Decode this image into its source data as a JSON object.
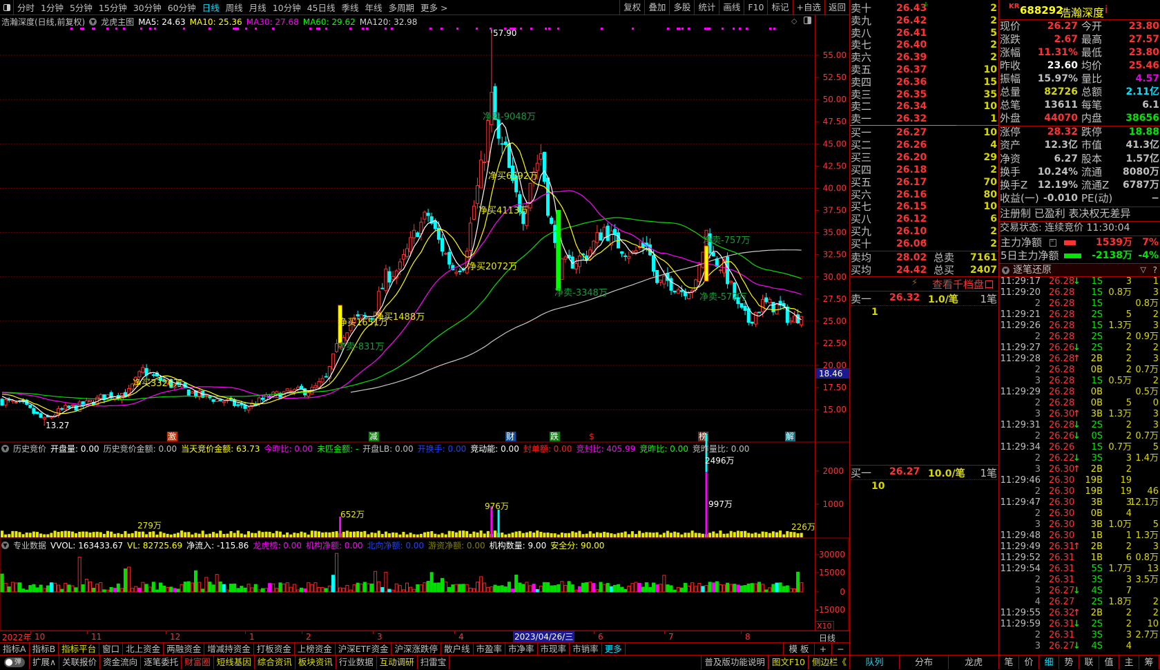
{
  "toolbar": {
    "periods": [
      "分时",
      "1分钟",
      "5分钟",
      "15分钟",
      "30分钟",
      "60分钟",
      "日线",
      "周线",
      "月线",
      "10分钟",
      "45日线",
      "季线",
      "年线",
      "多周期",
      "更多 >"
    ],
    "active": "日线",
    "actions": [
      "复权",
      "叠加",
      "多股",
      "统计",
      "画线",
      "F10",
      "标记",
      "+自选",
      "返回"
    ]
  },
  "info": {
    "title": "浩瀚深度(日线,前复权)",
    "mode": "龙虎主图",
    "ma": [
      {
        "text": "MA5: 24.63",
        "color": "#ffffff"
      },
      {
        "text": "MA10: 25.36",
        "color": "#ffff00"
      },
      {
        "text": "MA30: 27.68",
        "color": "#ff00ff"
      },
      {
        "text": "MA60: 29.62",
        "color": "#00ff00"
      },
      {
        "text": "MA120: 32.98",
        "color": "#d0d0d0"
      }
    ]
  },
  "price_axis": [
    "55.00",
    "52.50",
    "50.00",
    "47.50",
    "45.00",
    "42.50",
    "40.00",
    "37.50",
    "35.00",
    "32.50",
    "30.00",
    "27.50",
    "25.00",
    "22.50",
    "20.00",
    "17.50",
    "15.00"
  ],
  "current_marker": "18.46",
  "peak_label": "57.90",
  "low_label": "13.27",
  "annotations": [
    {
      "text": "净买3326万",
      "type": "buy"
    },
    {
      "text": "净卖-831万",
      "type": "sell"
    },
    {
      "text": "净买1651万",
      "type": "buy"
    },
    {
      "text": "净买1488万",
      "type": "buy"
    },
    {
      "text": "净买2072万",
      "type": "buy"
    },
    {
      "text": "净买4113万",
      "type": "buy"
    },
    {
      "text": "净买6592万",
      "type": "buy"
    },
    {
      "text": "净卖-9048万",
      "type": "sell"
    },
    {
      "text": "净卖-3348万",
      "type": "sell"
    },
    {
      "text": "净卖-757万",
      "type": "sell"
    },
    {
      "text": "净卖-572万",
      "type": "sell"
    }
  ],
  "events": [
    {
      "label": "激",
      "color": "#c03000"
    },
    {
      "label": "减",
      "color": "#108010"
    },
    {
      "label": "财",
      "color": "#1050a0"
    },
    {
      "label": "跌",
      "color": "#108010"
    },
    {
      "label": "$",
      "color": "#000000"
    },
    {
      "label": "榜",
      "color": "#703020"
    },
    {
      "label": "解",
      "color": "#107080"
    }
  ],
  "kline": {
    "count": 228,
    "keypoints": [
      [
        0,
        16
      ],
      [
        6,
        15.5
      ],
      [
        12,
        13.8
      ],
      [
        17,
        15
      ],
      [
        23,
        15.5
      ],
      [
        29,
        16.5
      ],
      [
        36,
        17
      ],
      [
        40,
        19.5
      ],
      [
        44,
        18.5
      ],
      [
        50,
        17.5
      ],
      [
        57,
        16.5
      ],
      [
        63,
        16
      ],
      [
        69,
        15.2
      ],
      [
        76,
        16.5
      ],
      [
        82,
        17
      ],
      [
        88,
        17.2
      ],
      [
        92,
        18.5
      ],
      [
        96,
        23
      ],
      [
        99,
        25
      ],
      [
        105,
        25.5
      ],
      [
        109,
        30
      ],
      [
        113,
        31
      ],
      [
        118,
        35.5
      ],
      [
        121,
        37
      ],
      [
        124,
        34
      ],
      [
        128,
        31
      ],
      [
        131,
        31.5
      ],
      [
        134,
        38
      ],
      [
        137,
        44
      ],
      [
        139,
        50
      ],
      [
        141,
        45
      ],
      [
        143,
        44
      ],
      [
        145,
        40
      ],
      [
        148,
        37
      ],
      [
        150,
        41
      ],
      [
        153,
        44
      ],
      [
        155,
        38
      ],
      [
        158,
        31
      ],
      [
        161,
        31.5
      ],
      [
        166,
        32.5
      ],
      [
        171,
        35.5
      ],
      [
        174,
        34
      ],
      [
        179,
        32.5
      ],
      [
        183,
        34
      ],
      [
        186,
        29
      ],
      [
        189,
        29.5
      ],
      [
        193,
        28.5
      ],
      [
        197,
        29
      ],
      [
        200,
        35
      ],
      [
        202,
        32
      ],
      [
        205,
        31
      ],
      [
        209,
        26.5
      ],
      [
        212,
        25
      ],
      [
        216,
        27
      ],
      [
        221,
        26.5
      ],
      [
        224,
        25
      ],
      [
        226,
        25.5
      ],
      [
        227,
        26.3
      ]
    ]
  },
  "ind1": {
    "items": [
      {
        "text": "开盘量: 0.00",
        "color": "#ffffff"
      },
      {
        "text": "历史竞价金额: 0.00",
        "color": "#c0c0c0"
      },
      {
        "text": "当天竞价金额: 63.73",
        "color": "#ffff00"
      },
      {
        "text": "今昨比: 0.00",
        "color": "#ff00ff"
      },
      {
        "text": "未匹金额: -",
        "color": "#00ff00"
      },
      {
        "text": "开盘LB: 0.00",
        "color": "#c0c0c0"
      },
      {
        "text": "开换手: 0.00",
        "color": "#2040ff"
      },
      {
        "text": "竞动能: 0.00",
        "color": "#ffffff"
      },
      {
        "text": "封单额: 0.00",
        "color": "#ff2020"
      },
      {
        "text": "竞封比: 405.99",
        "color": "#ff00ff"
      },
      {
        "text": "竞昨比: 0.00",
        "color": "#00ff00"
      },
      {
        "text": "竞昨量比: 0.00",
        "color": "#c0c0c0"
      }
    ],
    "title": "历史竞价",
    "axis": [
      "2000",
      "1000"
    ],
    "labels": [
      "2496万",
      "997万",
      "652万",
      "976万",
      "279万",
      "226万"
    ]
  },
  "ind2": {
    "title": "专业数据",
    "items": [
      {
        "text": "VVOL: 163433.67",
        "color": "#ffffff"
      },
      {
        "text": "VL: 82725.69",
        "color": "#ffff00"
      },
      {
        "text": "净流入: -115.86",
        "color": "#ffffff"
      },
      {
        "text": "龙虎榜: 0.00",
        "color": "#ff00ff"
      },
      {
        "text": "机构净额: 0.00",
        "color": "#ff00ff"
      },
      {
        "text": "北向净额: 0.00",
        "color": "#2040ff"
      },
      {
        "text": "游资净额: 0.00",
        "color": "#808000"
      },
      {
        "text": "机构数量: 9.00",
        "color": "#ffffff"
      },
      {
        "text": "安全分: 90.00",
        "color": "#ffff00"
      }
    ],
    "axis": [
      "30000",
      "15000",
      "0",
      "-15000"
    ],
    "scale": "X10"
  },
  "date_axis": {
    "year": "2022年",
    "months": [
      "10",
      "11",
      "12",
      "1",
      "2",
      "3",
      "4",
      "6",
      "7",
      "8"
    ],
    "cursor": "2023/04/26/三",
    "period": "日线"
  },
  "bar1": {
    "items": [
      {
        "t": "指标A",
        "c": "#c0c0c0"
      },
      {
        "t": "指标B",
        "c": "#c0c0c0"
      },
      {
        "t": "指标平台",
        "c": "#e0e000"
      },
      {
        "t": "窗口",
        "c": "#c0c0c0"
      },
      {
        "t": "北上资金",
        "c": "#c0c0c0"
      },
      {
        "t": "两融资金",
        "c": "#c0c0c0"
      },
      {
        "t": "增减持资金",
        "c": "#c0c0c0"
      },
      {
        "t": "打板资金",
        "c": "#c0c0c0"
      },
      {
        "t": "上榜资金",
        "c": "#c0c0c0"
      },
      {
        "t": "沪深ETF资金",
        "c": "#c0c0c0"
      },
      {
        "t": "沪深涨跌停",
        "c": "#c0c0c0"
      },
      {
        "t": "散户线",
        "c": "#c0c0c0"
      },
      {
        "t": "市盈率",
        "c": "#c0c0c0"
      },
      {
        "t": "市净率",
        "c": "#c0c0c0"
      },
      {
        "t": "市现率",
        "c": "#c0c0c0"
      },
      {
        "t": "市销率",
        "c": "#c0c0c0"
      },
      {
        "t": "更多",
        "c": "#00e0ff"
      }
    ],
    "template": "模 板",
    "plus": "+",
    "minus": "−"
  },
  "bar2": {
    "toggle": "弹",
    "items": [
      {
        "t": "扩展∧",
        "c": "#c0c0c0"
      },
      {
        "t": "关联报价",
        "c": "#c0c0c0"
      },
      {
        "t": "资金流向",
        "c": "#c0c0c0"
      },
      {
        "t": "逐笔委托",
        "c": "#c0c0c0"
      },
      {
        "t": "财富圈",
        "c": "#ff3030"
      },
      {
        "t": "短线基因",
        "c": "#e0e000"
      },
      {
        "t": "综合资讯",
        "c": "#e0e000"
      },
      {
        "t": "板块资讯",
        "c": "#e0e000"
      },
      {
        "t": "行业数据",
        "c": "#c0c0c0"
      },
      {
        "t": "互动调研",
        "c": "#e0e000"
      },
      {
        "t": "扫雷宝",
        "c": "#c0c0c0"
      }
    ],
    "right": [
      {
        "t": "普及版功能说明",
        "c": "#c0c0c0"
      },
      {
        "t": "图文F10",
        "c": "#e0e000"
      },
      {
        "t": "侧边栏《",
        "c": "#e0e000"
      }
    ]
  },
  "orderbook": {
    "sell": [
      {
        "label": "卖十",
        "price": "26.43",
        "vol": "2"
      },
      {
        "label": "卖九",
        "price": "26.42",
        "vol": "2"
      },
      {
        "label": "卖八",
        "price": "26.41",
        "vol": "5"
      },
      {
        "label": "卖七",
        "price": "26.40",
        "vol": "2"
      },
      {
        "label": "卖六",
        "price": "26.39",
        "vol": "2"
      },
      {
        "label": "卖五",
        "price": "26.37",
        "vol": "10"
      },
      {
        "label": "卖四",
        "price": "26.36",
        "vol": "15"
      },
      {
        "label": "卖三",
        "price": "26.35",
        "vol": "35"
      },
      {
        "label": "卖二",
        "price": "26.34",
        "vol": "10"
      },
      {
        "label": "卖一",
        "price": "26.32",
        "vol": "1"
      }
    ],
    "buy": [
      {
        "label": "买一",
        "price": "26.27",
        "vol": "10"
      },
      {
        "label": "买二",
        "price": "26.26",
        "vol": "4"
      },
      {
        "label": "买三",
        "price": "26.20",
        "vol": "29"
      },
      {
        "label": "买四",
        "price": "26.18",
        "vol": "2"
      },
      {
        "label": "买五",
        "price": "26.17",
        "vol": "70"
      },
      {
        "label": "买六",
        "price": "26.16",
        "vol": "80"
      },
      {
        "label": "买七",
        "price": "26.15",
        "vol": "10"
      },
      {
        "label": "买八",
        "price": "26.12",
        "vol": "6"
      },
      {
        "label": "买九",
        "price": "26.10",
        "vol": "2"
      },
      {
        "label": "买十",
        "price": "26.06",
        "vol": "2"
      }
    ],
    "avg": [
      {
        "label": "卖均",
        "price": "28.02",
        "tlabel": "总卖",
        "tval": "7161"
      },
      {
        "label": "买均",
        "price": "24.42",
        "tlabel": "总买",
        "tval": "2407"
      }
    ],
    "depth_link": "查看千档盘口",
    "queue": [
      {
        "label": "卖一",
        "price": "26.32",
        "per": "1.0/笔",
        "count": "1笔",
        "orders": "1"
      },
      {
        "label": "买一",
        "price": "26.27",
        "per": "10.0/笔",
        "count": "1笔",
        "orders": "10"
      }
    ],
    "tabs": [
      "队列",
      "分布",
      "龙虎"
    ]
  },
  "quote": {
    "badge": "KR",
    "code": "688292",
    "name": "浩瀚深度",
    "info_icon": "i",
    "rows": [
      {
        "l1": "现价",
        "v1": "26.27",
        "c1": "#ff3232",
        "l2": "今开",
        "v2": "23.80",
        "c2": "#ff3232"
      },
      {
        "l1": "涨跌",
        "v1": "2.67",
        "c1": "#ff3232",
        "l2": "最高",
        "v2": "27.57",
        "c2": "#ff3232"
      },
      {
        "l1": "涨幅",
        "v1": "11.31%",
        "c1": "#ff3232",
        "l2": "最低",
        "v2": "23.80",
        "c2": "#ff3232"
      },
      {
        "l1": "昨收",
        "v1": "23.60",
        "c1": "#ffffff",
        "l2": "均价",
        "v2": "25.46",
        "c2": "#ff3232"
      },
      {
        "l1": "振幅",
        "v1": "15.97%",
        "c1": "#c0c0c0",
        "l2": "量比",
        "v2": "4.57",
        "c2": "#e000e0"
      },
      {
        "l1": "总量",
        "v1": "82726",
        "c1": "#d8d800",
        "l2": "总额",
        "v2": "2.11亿",
        "c2": "#00e0ff"
      },
      {
        "l1": "总笔",
        "v1": "13611",
        "c1": "#c0c0c0",
        "l2": "每笔",
        "v2": "6.1",
        "c2": "#c0c0c0"
      },
      {
        "l1": "外盘",
        "v1": "44070",
        "c1": "#ff3232",
        "l2": "内盘",
        "v2": "38656",
        "c2": "#00e600"
      },
      {
        "l1": "涨停",
        "v1": "28.32",
        "c1": "#ff3232",
        "l2": "跌停",
        "v2": "18.88",
        "c2": "#00e600"
      },
      {
        "l1": "资产",
        "v1": "12.3亿",
        "c1": "#c0c0c0",
        "l2": "市值",
        "v2": "41.3亿",
        "c2": "#c0c0c0"
      },
      {
        "l1": "净资",
        "v1": "6.27",
        "c1": "#c0c0c0",
        "l2": "股本",
        "v2": "1.57亿",
        "c2": "#c0c0c0"
      },
      {
        "l1": "换手",
        "v1": "10.24%",
        "c1": "#c0c0c0",
        "l2": "流通",
        "v2": "8080万",
        "c2": "#c0c0c0"
      },
      {
        "l1": "换手Z",
        "v1": "12.19%",
        "c1": "#c0c0c0",
        "l2": "流通Z",
        "v2": "6787万",
        "c2": "#c0c0c0"
      },
      {
        "l1": "收益(一)",
        "v1": "-0.010",
        "c1": "#c0c0c0",
        "l2": "PE(动)",
        "v2": "−",
        "c2": "#c0c0c0"
      }
    ],
    "flags": "注册制 已盈利 表决权无差异",
    "status": "交易状态: 连续竞价 11:30:04",
    "mainforce": [
      {
        "label": "主力净额",
        "value": "1539万",
        "pct": "7%",
        "color": "#ff3232"
      },
      {
        "label": "5日主力净额",
        "value": "-2138万",
        "pct": "-4%",
        "color": "#00e600"
      }
    ],
    "ticks_title": "逐笔还原",
    "tabs": [
      "笔",
      "价",
      "细",
      "势",
      "联",
      "值",
      "主",
      "筹"
    ],
    "active_tab": "细"
  },
  "ticks": [
    {
      "t": "11:29:17",
      "p": "26.28",
      "a": "down",
      "v": "1S",
      "c4": "3",
      "c5": "1"
    },
    {
      "t": "11:29:20",
      "p": "26.28",
      "a": "",
      "v": "1S",
      "c4": "0.8万",
      "c5": "3"
    },
    {
      "t": "2",
      "p": "26.28",
      "a": "",
      "v": "1S",
      "c4": "",
      "c5": "0.8万"
    },
    {
      "t": "11:29:21",
      "p": "26.28",
      "a": "",
      "v": "2S",
      "c4": "5",
      "c5": "2"
    },
    {
      "t": "11:29:26",
      "p": "26.28",
      "a": "",
      "v": "1S",
      "c4": "1.3万",
      "c5": "3"
    },
    {
      "t": "2",
      "p": "26.28",
      "a": "",
      "v": "2S",
      "c4": "2",
      "c5": "0.9万"
    },
    {
      "t": "11:29:27",
      "p": "26.26",
      "a": "down",
      "v": "2S",
      "c4": "2",
      "c5": "2"
    },
    {
      "t": "11:29:28",
      "p": "26.28",
      "a": "up",
      "v": "2B",
      "c4": "2",
      "c5": "3"
    },
    {
      "t": "2",
      "p": "26.28",
      "a": "",
      "v": "0B",
      "c4": "2",
      "c5": "0.7万"
    },
    {
      "t": "3",
      "p": "26.28",
      "a": "",
      "v": "1S",
      "c4": "0.5万",
      "c5": "2"
    },
    {
      "t": "11:29:29",
      "p": "26.28",
      "a": "",
      "v": "0B",
      "c4": "",
      "c5": "0.5万"
    },
    {
      "t": "2",
      "p": "26.28",
      "a": "",
      "v": "0B",
      "c4": "5",
      "c5": "0"
    },
    {
      "t": "3",
      "p": "26.30",
      "a": "up",
      "v": "3B",
      "c4": "1.3万",
      "c5": "3"
    },
    {
      "t": "11:29:31",
      "p": "26.28",
      "a": "down",
      "v": "2S",
      "c4": "2",
      "c5": "3"
    },
    {
      "t": "2",
      "p": "26.26",
      "a": "down",
      "v": "0S",
      "c4": "2",
      "c5": "0.7万"
    },
    {
      "t": "11:29:34",
      "p": "26.26",
      "a": "",
      "v": "1S",
      "c4": "0.7万",
      "c5": "5"
    },
    {
      "t": "2",
      "p": "26.22",
      "a": "down",
      "v": "3S",
      "c4": "3",
      "c5": "1.4万"
    },
    {
      "t": "3",
      "p": "26.30",
      "a": "up",
      "v": "2B",
      "c4": "2",
      "c5": ""
    },
    {
      "t": "11:29:46",
      "p": "26.30",
      "a": "",
      "v": "19B",
      "c4": "19",
      "c5": ""
    },
    {
      "t": "2",
      "p": "26.30",
      "a": "",
      "v": "19B",
      "c4": "19",
      "c5": "46"
    },
    {
      "t": "11:29:47",
      "p": "26.30",
      "a": "",
      "v": "3B",
      "c4": "3",
      "c5": "12.1万"
    },
    {
      "t": "2",
      "p": "26.30",
      "a": "",
      "v": "0B",
      "c4": "4",
      "c5": ""
    },
    {
      "t": "3",
      "p": "26.30",
      "a": "",
      "v": "3B",
      "c4": "1.0万",
      "c5": "5"
    },
    {
      "t": "11:29:48",
      "p": "26.30",
      "a": "",
      "v": "1B",
      "c4": "1",
      "c5": "1.3万"
    },
    {
      "t": "11:29:49",
      "p": "26.31",
      "a": "up",
      "v": "2B",
      "c4": "2",
      "c5": "3"
    },
    {
      "t": "11:29:52",
      "p": "26.31",
      "a": "",
      "v": "1B",
      "c4": "6",
      "c5": "0.8万"
    },
    {
      "t": "11:29:54",
      "p": "26.31",
      "a": "",
      "v": "5S",
      "c4": "1.7万",
      "c5": "13"
    },
    {
      "t": "2",
      "p": "26.31",
      "a": "",
      "v": "3S",
      "c4": "3",
      "c5": "3.5万"
    },
    {
      "t": "3",
      "p": "26.27",
      "a": "down",
      "v": "4S",
      "c4": "7",
      "c5": ""
    },
    {
      "t": "4",
      "p": "26.27",
      "a": "",
      "v": "2S",
      "c4": "1.8万",
      "c5": "2"
    },
    {
      "t": "11:29:55",
      "p": "26.32",
      "a": "up",
      "v": "2B",
      "c4": "2",
      "c5": "2"
    },
    {
      "t": "11:29:59",
      "p": "26.31",
      "a": "down",
      "v": "2S",
      "c4": "2",
      "c5": "10"
    },
    {
      "t": "2",
      "p": "26.31",
      "a": "",
      "v": "3S",
      "c4": "3",
      "c5": "2.7万"
    },
    {
      "t": "3",
      "p": "26.27",
      "a": "down",
      "v": "4S",
      "c4": "4",
      "c5": ""
    }
  ]
}
